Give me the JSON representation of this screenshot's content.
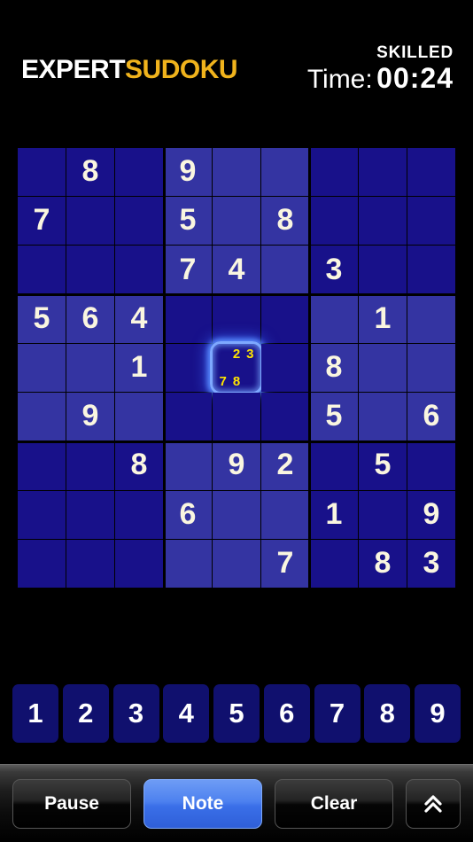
{
  "header": {
    "logo_part1": "EXPERT",
    "logo_part2": "SUDOKU",
    "difficulty": "SKILLED",
    "timer_label": "Time:",
    "timer_value": "00:24",
    "logo_color_primary": "#ffffff",
    "logo_color_accent": "#f0b31c"
  },
  "board": {
    "size": 9,
    "colors": {
      "block_dark": "#18118a",
      "block_light": "#3434a2",
      "digit": "#faf6e0",
      "note": "#ffe500",
      "selection_glow": "#7ea8ff",
      "grid_line": "#000000"
    },
    "cells": [
      [
        null,
        "8",
        null,
        "9",
        null,
        null,
        null,
        null,
        null
      ],
      [
        "7",
        null,
        null,
        "5",
        null,
        "8",
        null,
        null,
        null
      ],
      [
        null,
        null,
        null,
        "7",
        "4",
        null,
        "3",
        null,
        null
      ],
      [
        "5",
        "6",
        "4",
        null,
        null,
        null,
        null,
        "1",
        null
      ],
      [
        null,
        null,
        "1",
        null,
        null,
        null,
        "8",
        null,
        null
      ],
      [
        null,
        "9",
        null,
        null,
        null,
        null,
        "5",
        null,
        "6"
      ],
      [
        null,
        null,
        "8",
        null,
        "9",
        "2",
        null,
        "5",
        null
      ],
      [
        null,
        null,
        null,
        "6",
        null,
        null,
        "1",
        null,
        "9"
      ],
      [
        null,
        null,
        null,
        null,
        null,
        "7",
        null,
        "8",
        "3"
      ]
    ],
    "selected_cell": {
      "row": 4,
      "col": 4
    },
    "notes": {
      "row": 4,
      "col": 4,
      "values": [
        "2",
        "3",
        "7",
        "8"
      ],
      "slots": [
        null,
        "2",
        "3",
        null,
        null,
        null,
        "7",
        "8",
        null
      ]
    }
  },
  "numpad": {
    "keys": [
      "1",
      "2",
      "3",
      "4",
      "5",
      "6",
      "7",
      "8",
      "9"
    ]
  },
  "toolbar": {
    "pause_label": "Pause",
    "note_label": "Note",
    "clear_label": "Clear",
    "note_active": true,
    "up_icon": "double-chevron-up-icon",
    "active_color": "#4d81ef"
  }
}
